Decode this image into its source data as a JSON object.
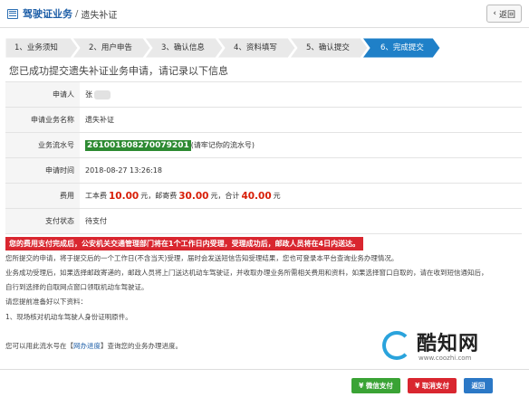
{
  "header": {
    "title": "驾驶证业务",
    "separator": "/",
    "subtitle": "遗失补证",
    "back_label": "返回",
    "back_icon": "chevron-left-icon"
  },
  "steps": [
    {
      "label": "1、业务须知",
      "active": false
    },
    {
      "label": "2、用户申告",
      "active": false
    },
    {
      "label": "3、确认信息",
      "active": false
    },
    {
      "label": "4、资料填写",
      "active": false
    },
    {
      "label": "5、确认提交",
      "active": false
    },
    {
      "label": "6、完成提交",
      "active": true
    }
  ],
  "colors": {
    "step_active": "#1f80c8",
    "step_inactive": "#e9e9e9",
    "notice_bg": "#d9262f",
    "serial_bg": "#2d8a32"
  },
  "page_title": "您已成功提交遗失补证业务申请，请记录以下信息",
  "table": {
    "applicant_label": "申请人",
    "applicant_value": "张",
    "biz_name_label": "申请业务名称",
    "biz_name_value": "遗失补证",
    "serial_label": "业务流水号",
    "serial_value": "261001808270079201",
    "serial_note": "(请牢记你的流水号)",
    "time_label": "申请时间",
    "time_value": "2018-08-27 13:26:18",
    "fee_label": "费用",
    "fee_text1": "工本费",
    "fee_amount1": "10.00",
    "fee_text2": "元，邮寄费",
    "fee_amount2": "30.00",
    "fee_text3": "元，合计",
    "fee_amount3": "40.00",
    "fee_text4": "元",
    "pay_label": "支付状态",
    "pay_value": "待支付"
  },
  "notice": "您的费用支付完成后，公安机关交通管理部门将在1个工作日内受理，受理成功后，邮政人员将在4日内送达。",
  "paragraphs": [
    "您所提交的申请，将于提交后的一个工作日(不含当天)受理，届时会发送短信告知受理结果，您也可登录本平台查询业务办理情况。",
    "业务成功受理后，如果选择邮政寄递的，邮政人员将上门送达机动车驾驶证，并收取办理业务所需相关费用和资料，如果选择窗口自取的，请在收到短信通知后，",
    "自行到选择的自取网点窗口领取机动车驾驶证。",
    "请您提前准备好以下资料：",
    "1、现场核对机动车驾驶人身份证明原件。"
  ],
  "check_text_before": "您可以用此流水号在【",
  "check_link": "网办进度",
  "check_text_after": "】查询您的业务办理进度。",
  "watermark": {
    "text": "酷知网",
    "url": "www.coozhi.com"
  },
  "footer": {
    "wechat_pay": "¥ 微信支付",
    "cancel_pay": "¥ 取消支付",
    "back": "返回"
  }
}
